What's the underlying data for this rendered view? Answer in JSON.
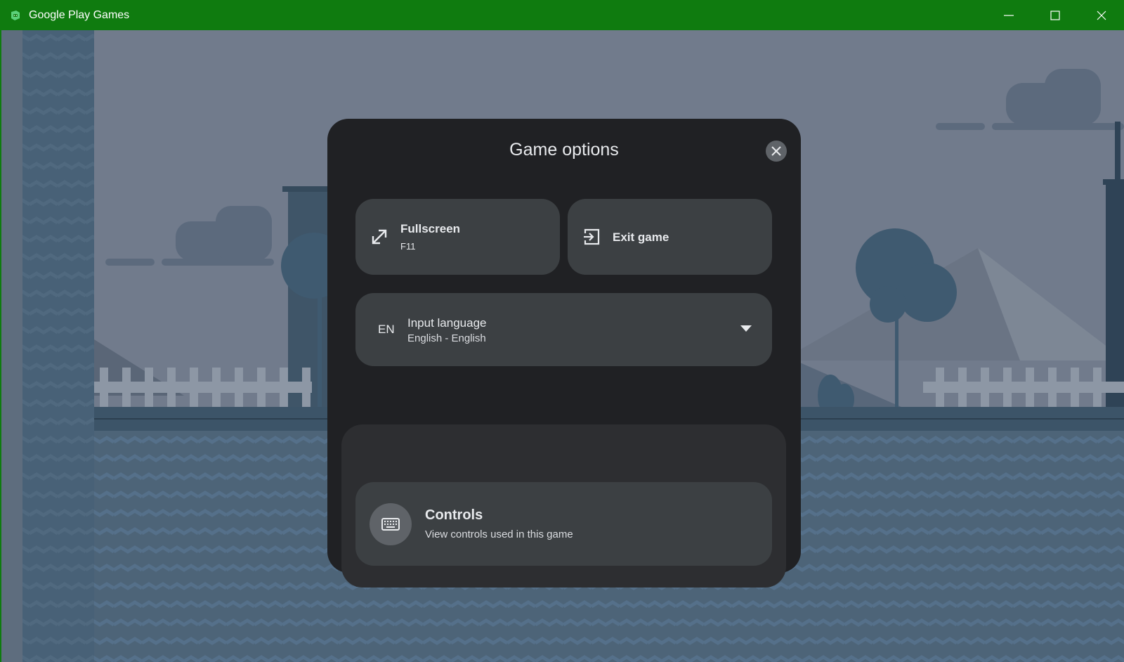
{
  "window": {
    "title": "Google Play Games",
    "titlebar_color": "#0f7b0f",
    "buttons": {
      "minimize_icon": "minimize-icon",
      "maximize_icon": "maximize-icon",
      "close_icon": "close-icon"
    }
  },
  "dialog": {
    "title": "Game options",
    "background": "#202124",
    "tile_color": "#3c4043",
    "fullscreen": {
      "label": "Fullscreen",
      "shortcut": "F11",
      "icon": "expand-arrows-icon"
    },
    "exit": {
      "label": "Exit game",
      "icon": "exit-icon"
    },
    "input_language": {
      "code": "EN",
      "label": "Input language",
      "value": "English - English",
      "icon": "dropdown-caret-icon"
    },
    "controls": {
      "label": "Controls",
      "description": "View controls used in this game",
      "icon": "keyboard-icon"
    }
  }
}
